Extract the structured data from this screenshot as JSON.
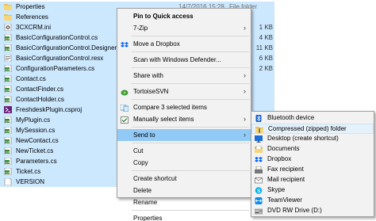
{
  "files": [
    {
      "name": "Properties",
      "icon": "folder-icon",
      "size": "",
      "date": "14/7/2016 15:28",
      "type": "File folder",
      "selected": true
    },
    {
      "name": "References",
      "icon": "folder-icon",
      "size": "",
      "selected": true
    },
    {
      "name": "3CXCRM.ini",
      "icon": "ini-file-icon",
      "size": "1 KB",
      "selected": true
    },
    {
      "name": "BasicConfigurationControl.cs",
      "icon": "cs-file-icon",
      "size": "4 KB",
      "selected": true
    },
    {
      "name": "BasicConfigurationControl.Designer.cs",
      "icon": "cs-file-icon",
      "size": "11 KB",
      "selected": true
    },
    {
      "name": "BasicConfigurationControl.resx",
      "icon": "resx-file-icon",
      "size": "6 KB",
      "selected": true
    },
    {
      "name": "ConfigurationParameters.cs",
      "icon": "cs-file-icon",
      "size": "2 KB",
      "selected": true
    },
    {
      "name": "Contact.cs",
      "icon": "cs-file-icon",
      "size": "",
      "selected": true
    },
    {
      "name": "ContactFinder.cs",
      "icon": "cs-file-icon",
      "size": "",
      "selected": true
    },
    {
      "name": "ContactHolder.cs",
      "icon": "cs-file-icon",
      "size": "",
      "selected": true
    },
    {
      "name": "FreshdeskPlugin.csproj",
      "icon": "csproj-file-icon",
      "size": "",
      "selected": true
    },
    {
      "name": "MyPlugin.cs",
      "icon": "cs-file-icon",
      "size": "",
      "selected": true
    },
    {
      "name": "MySession.cs",
      "icon": "cs-file-icon",
      "size": "",
      "selected": true
    },
    {
      "name": "NewContact.cs",
      "icon": "cs-file-icon",
      "size": "",
      "selected": true
    },
    {
      "name": "NewTicket.cs",
      "icon": "cs-file-icon",
      "size": "",
      "selected": true
    },
    {
      "name": "Parameters.cs",
      "icon": "cs-file-icon",
      "size": "",
      "selected": true
    },
    {
      "name": "Ticket.cs",
      "icon": "cs-file-icon",
      "size": "",
      "selected": true
    },
    {
      "name": "VERSION",
      "icon": "generic-file-icon",
      "size": "",
      "selected": true
    }
  ],
  "context_menu": {
    "items": [
      {
        "label": "Pin to Quick access",
        "bold": true,
        "icon": "",
        "arrow": false
      },
      {
        "label": "7-Zip",
        "icon": "",
        "arrow": true
      },
      {
        "sep": true
      },
      {
        "label": "Move a Dropbox",
        "icon": "dropbox-icon",
        "arrow": false
      },
      {
        "sep": true
      },
      {
        "label": "Scan with Windows Defender...",
        "icon": "",
        "arrow": false
      },
      {
        "sep": true
      },
      {
        "label": "Share with",
        "icon": "",
        "arrow": true
      },
      {
        "sep": true
      },
      {
        "label": "TortoiseSVN",
        "icon": "tortoisesvn-icon",
        "arrow": true
      },
      {
        "sep": true
      },
      {
        "label": "Compare 3 selected items",
        "icon": "compare-icon",
        "arrow": false
      },
      {
        "label": "Manually select items",
        "icon": "select-icon",
        "arrow": true
      },
      {
        "sep": true
      },
      {
        "label": "Send to",
        "icon": "",
        "arrow": true,
        "highlighted": true
      },
      {
        "sep": true
      },
      {
        "label": "Cut",
        "icon": "",
        "arrow": false
      },
      {
        "label": "Copy",
        "icon": "",
        "arrow": false
      },
      {
        "sep": true
      },
      {
        "label": "Create shortcut",
        "icon": "",
        "arrow": false
      },
      {
        "label": "Delete",
        "icon": "",
        "arrow": false
      },
      {
        "label": "Rename",
        "icon": "",
        "arrow": false
      },
      {
        "sep": true
      },
      {
        "label": "Properties",
        "icon": "",
        "arrow": false
      }
    ]
  },
  "sendto_menu": {
    "items": [
      {
        "label": "Bluetooth device",
        "icon": "bluetooth-icon"
      },
      {
        "label": "Compressed (zipped) folder",
        "icon": "zip-folder-icon",
        "highlighted": true
      },
      {
        "label": "Desktop (create shortcut)",
        "icon": "desktop-icon"
      },
      {
        "label": "Documents",
        "icon": "documents-icon"
      },
      {
        "label": "Dropbox",
        "icon": "dropbox-icon"
      },
      {
        "label": "Fax recipient",
        "icon": "fax-icon"
      },
      {
        "label": "Mail recipient",
        "icon": "mail-icon"
      },
      {
        "label": "Skype",
        "icon": "skype-icon"
      },
      {
        "label": "TeamViewer",
        "icon": "teamviewer-icon"
      },
      {
        "label": "DVD RW Drive (D:)",
        "icon": "dvd-drive-icon"
      }
    ]
  },
  "colors": {
    "selection": "#cce8ff",
    "menu_bg": "#f2f2f2",
    "menu_highlight": "#91c9f7",
    "folder": "#e8c050",
    "cs_file": "#3a8a3a",
    "dropbox": "#0061fe"
  }
}
